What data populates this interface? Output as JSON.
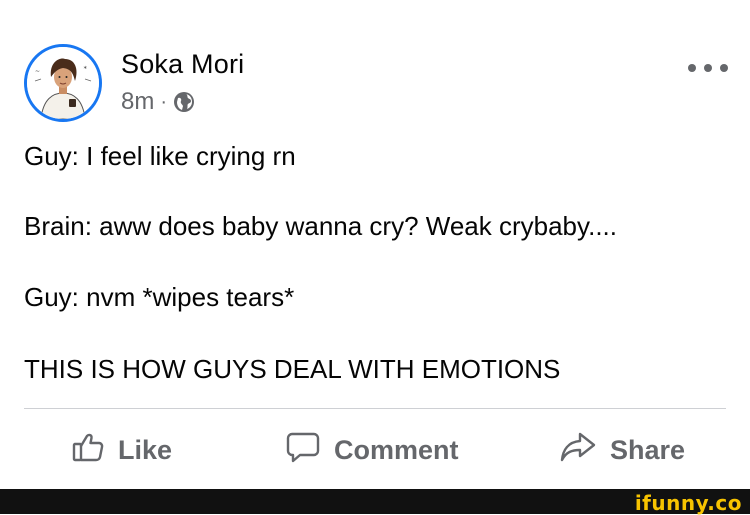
{
  "post": {
    "author": "Soka Mori",
    "time": "8m",
    "separator": "·",
    "lines": [
      "Guy: I feel like crying rn",
      "Brain: aww does baby wanna cry? Weak crybaby....",
      "Guy: nvm *wipes tears*",
      "THIS IS HOW GUYS DEAL WITH EMOTIONS"
    ]
  },
  "actions": {
    "like": "Like",
    "comment": "Comment",
    "share": "Share"
  },
  "watermark": "ifunny.co",
  "colors": {
    "accent": "#1877f2",
    "secondary_text": "#65676b",
    "top_bar": "#c9ccd1",
    "footer": "#111111",
    "watermark": "#f7c300"
  },
  "icons": [
    "avatar",
    "globe-icon",
    "more-icon",
    "like-icon",
    "comment-icon",
    "share-icon"
  ]
}
